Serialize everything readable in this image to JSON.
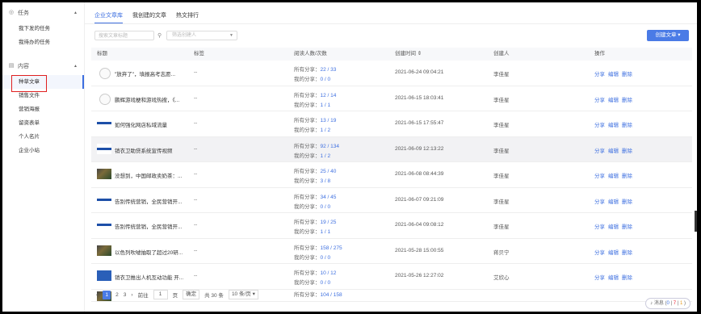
{
  "sidebar": {
    "group_task": "任务",
    "task_items": [
      "我下发的任务",
      "我待办的任务"
    ],
    "group_content": "内容",
    "content_items": [
      "种草文章",
      "销售文件",
      "营销海报",
      "留资表单",
      "个人名片",
      "企业小站"
    ]
  },
  "tabs": [
    "企业文章库",
    "我创建的文章",
    "热文排行"
  ],
  "toolbar": {
    "search_placeholder": "搜索文章标题",
    "creator_placeholder": "筛选创建人",
    "create_label": "创建文章 ▾"
  },
  "table": {
    "headers": [
      "标题",
      "标签",
      "阅读人数/次数",
      "创建时间 ⇕",
      "创建人",
      "操作"
    ],
    "stat_prefix_all": "所有分享：",
    "stat_prefix_mine": "我的分享：",
    "rows": [
      {
        "title": "\"放弃了\"，填报高考志愿...",
        "tag": "--",
        "all": "22 / 33",
        "mine": "0 / 0",
        "time": "2021-06-24 09:04:21",
        "creator": "李佳星",
        "thumb": "circle"
      },
      {
        "title": "鹏辉游戏梗和游戏热搜，《...",
        "tag": "--",
        "all": "12 / 14",
        "mine": "1 / 1",
        "time": "2021-06-15 18:03:41",
        "creator": "李佳星",
        "thumb": "circle"
      },
      {
        "title": "如何强化网店私域流量",
        "tag": "--",
        "all": "13 / 19",
        "mine": "1 / 2",
        "time": "2021-06-15 17:55:47",
        "creator": "李佳星",
        "thumb": "logo"
      },
      {
        "title": "销衣卫助贷系统宣传视频",
        "tag": "--",
        "all": "92 / 134",
        "mine": "1 / 2",
        "time": "2021-06-09 12:13:22",
        "creator": "李佳星",
        "thumb": "logo"
      },
      {
        "title": "没想到，中国邮政卖奶茶：...",
        "tag": "--",
        "all": "25 / 40",
        "mine": "3 / 8",
        "time": "2021-06-08 08:44:39",
        "creator": "李佳星",
        "thumb": "photo"
      },
      {
        "title": "告别传统营销，全民营销开...",
        "tag": "--",
        "all": "34 / 45",
        "mine": "0 / 0",
        "time": "2021-06-07 09:21:09",
        "creator": "李佳星",
        "thumb": "logo"
      },
      {
        "title": "告别传统营销，全民营销开...",
        "tag": "--",
        "all": "19 / 25",
        "mine": "1 / 1",
        "time": "2021-06-04 09:08:12",
        "creator": "李佳星",
        "thumb": "logo"
      },
      {
        "title": "以色列吹嘘抽取了超过20研...",
        "tag": "--",
        "all": "158 / 275",
        "mine": "0 / 0",
        "time": "2021-05-28 15:00:55",
        "creator": "蒋贝宁",
        "thumb": "photo"
      },
      {
        "title": "销衣卫推出人机互动功能 开...",
        "tag": "--",
        "all": "10 / 12",
        "mine": "0 / 0",
        "time": "2021-05-26 12:27:02",
        "creator": "艾欣心",
        "thumb": "blue"
      },
      {
        "title": "",
        "tag": "",
        "all": "104 / 158",
        "mine": "",
        "time": "",
        "creator": "",
        "thumb": "photo"
      }
    ],
    "ops": [
      "分享",
      "编辑",
      "删除"
    ]
  },
  "pager": {
    "prev": "‹",
    "pages": [
      "1",
      "2",
      "3"
    ],
    "next": "›",
    "goto_label": "前往",
    "goto_value": "1",
    "goto_unit": "页",
    "confirm": "确定",
    "total": "共 30 条",
    "per_page": "10 条/页 ▾"
  },
  "message": {
    "label": "消息 (",
    "n1": "0",
    "sep1": " | ",
    "n2": "7",
    "sep2": " | ",
    "n3": "1",
    "end": " )"
  }
}
